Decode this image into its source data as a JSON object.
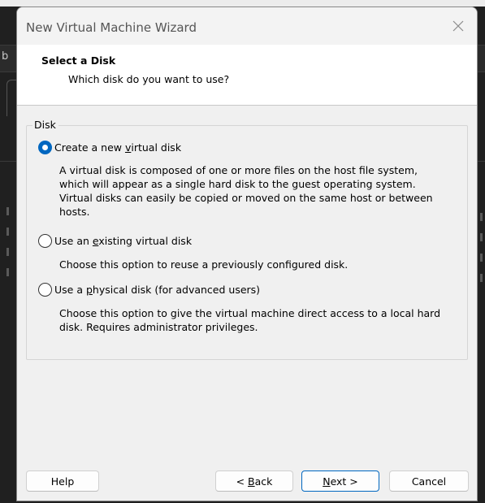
{
  "background": {
    "left_char": "b"
  },
  "dialog": {
    "title": "New Virtual Machine Wizard",
    "header": {
      "title": "Select a Disk",
      "subtitle": "Which disk do you want to use?"
    },
    "group": {
      "label": "Disk"
    },
    "options": [
      {
        "label_pre": "Create a new ",
        "label_mnemonic": "v",
        "label_post": "irtual disk",
        "selected": true,
        "description_lines": [
          "A virtual disk is composed of one or more files on the host file system,",
          "which will appear as a single hard disk to the guest operating system.",
          "Virtual disks can easily be copied or moved on the same host or between",
          "hosts."
        ]
      },
      {
        "label_pre": "Use an ",
        "label_mnemonic": "e",
        "label_post": "xisting virtual disk",
        "selected": false,
        "description_lines": [
          "Choose this option to reuse a previously configured disk."
        ]
      },
      {
        "label_pre": "Use a ",
        "label_mnemonic": "p",
        "label_post": "hysical disk (for advanced users)",
        "selected": false,
        "description_lines": [
          "Choose this option to give the virtual machine direct access to a local hard",
          "disk. Requires administrator privileges."
        ]
      }
    ],
    "buttons": {
      "help": "Help",
      "back_pre": "< ",
      "back_mnemonic": "B",
      "back_post": "ack",
      "next_mnemonic": "N",
      "next_post": "ext >",
      "cancel": "Cancel"
    },
    "accent_color": "#0067c0"
  }
}
